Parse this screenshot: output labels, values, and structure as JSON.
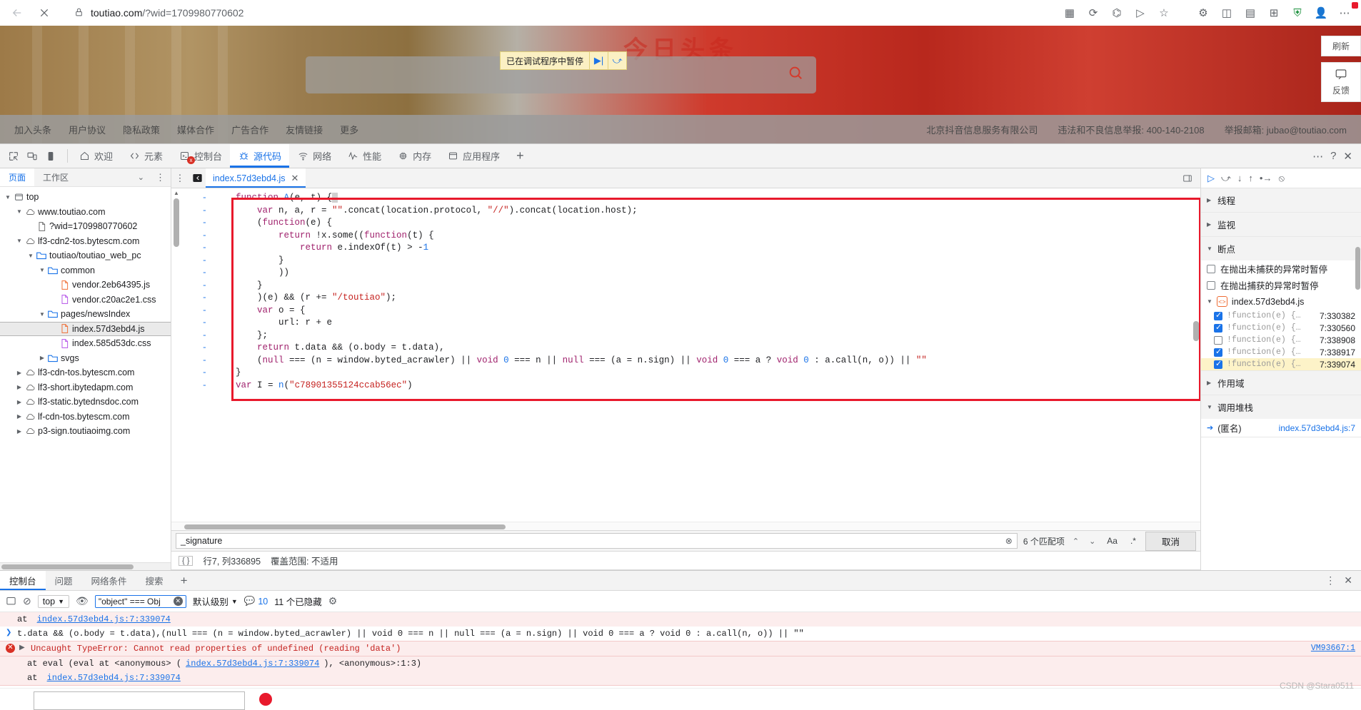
{
  "browser": {
    "url_main": "toutiao.com",
    "url_query": "/?wid=1709980770602",
    "lock_icon": "lock-icon",
    "back_icon": "←",
    "close_icon": "✕"
  },
  "page": {
    "watermark": "今日头条",
    "footer_links": [
      "加入头条",
      "用户协议",
      "隐私政策",
      "媒体合作",
      "广告合作",
      "友情链接",
      "更多"
    ],
    "footer_right": [
      "北京抖音信息服务有限公司",
      "违法和不良信息举报: 400-140-2108",
      "举报邮箱: jubao@toutiao.com"
    ],
    "pause_banner": "已在调试程序中暂停",
    "edge_buttons": [
      {
        "label": "刷新"
      },
      {
        "label": "反馈"
      }
    ]
  },
  "devtools": {
    "tabs": [
      {
        "label": "欢迎",
        "icon": "home-icon",
        "active": false
      },
      {
        "label": "元素",
        "icon": "code-icon",
        "active": false
      },
      {
        "label": "控制台",
        "icon": "console-icon",
        "active": false,
        "badge": "x"
      },
      {
        "label": "源代码",
        "icon": "bug-icon",
        "active": true
      },
      {
        "label": "网络",
        "icon": "wifi-icon",
        "active": false
      },
      {
        "label": "性能",
        "icon": "pulse-icon",
        "active": false
      },
      {
        "label": "内存",
        "icon": "chip-icon",
        "active": false
      },
      {
        "label": "应用程序",
        "icon": "app-icon",
        "active": false
      }
    ],
    "add_tab": "+",
    "navigator": {
      "tabs": [
        {
          "label": "页面",
          "active": true
        },
        {
          "label": "工作区",
          "active": false
        }
      ],
      "tree": [
        {
          "indent": 0,
          "twisty": "▼",
          "icon": "frame-icon",
          "label": "top"
        },
        {
          "indent": 1,
          "twisty": "▼",
          "icon": "cloud-icon",
          "label": "www.toutiao.com"
        },
        {
          "indent": 2,
          "twisty": "",
          "icon": "doc-icon",
          "label": "?wid=1709980770602"
        },
        {
          "indent": 1,
          "twisty": "▼",
          "icon": "cloud-icon",
          "label": "lf3-cdn2-tos.bytescm.com"
        },
        {
          "indent": 2,
          "twisty": "▼",
          "icon": "folder-icon",
          "label": "toutiao/toutiao_web_pc"
        },
        {
          "indent": 3,
          "twisty": "▼",
          "icon": "folder-icon",
          "label": "common"
        },
        {
          "indent": 4,
          "twisty": "",
          "icon": "js-icon",
          "label": "vendor.2eb64395.js"
        },
        {
          "indent": 4,
          "twisty": "",
          "icon": "css-icon",
          "label": "vendor.c20ac2e1.css"
        },
        {
          "indent": 3,
          "twisty": "▼",
          "icon": "folder-icon",
          "label": "pages/newsIndex"
        },
        {
          "indent": 4,
          "twisty": "",
          "icon": "js-icon",
          "label": "index.57d3ebd4.js",
          "selected": true
        },
        {
          "indent": 4,
          "twisty": "",
          "icon": "css-icon",
          "label": "index.585d53dc.css"
        },
        {
          "indent": 3,
          "twisty": "▶",
          "icon": "folder-icon",
          "label": "svgs"
        },
        {
          "indent": 1,
          "twisty": "▶",
          "icon": "cloud-icon",
          "label": "lf3-cdn-tos.bytescm.com"
        },
        {
          "indent": 1,
          "twisty": "▶",
          "icon": "cloud-icon",
          "label": "lf3-short.ibytedapm.com"
        },
        {
          "indent": 1,
          "twisty": "▶",
          "icon": "cloud-icon",
          "label": "lf3-static.bytednsdoc.com"
        },
        {
          "indent": 1,
          "twisty": "▶",
          "icon": "cloud-icon",
          "label": "lf-cdn-tos.bytescm.com"
        },
        {
          "indent": 1,
          "twisty": "▶",
          "icon": "cloud-icon",
          "label": "p3-sign.toutiaoimg.com"
        }
      ]
    },
    "editor": {
      "tab_label": "index.57d3ebd4.js",
      "line_marker": "-",
      "code_lines": [
        "    function A(e, t) {",
        "        var n, a, r = \"\".concat(location.protocol, \"//\").concat(location.host);",
        "        (function(e) {",
        "            return !x.some((function(t) {",
        "                return e.indexOf(t) > -1",
        "            }",
        "            ))",
        "        }",
        "        )(e) && (r += \"/toutiao\");",
        "        var o = {",
        "            url: r + e",
        "        };",
        "        return t.data && (o.body = t.data),",
        "        (null === (n = window.byted_acrawler) || void 0 === n || null === (a = n.sign) || void 0 === a ? void 0 : a.call(n, o)) || \"\"",
        "    }",
        "    var I = n(\"c78901355124ccab56ec\")"
      ],
      "find_value": "_signature",
      "find_matches": "6 个匹配项",
      "find_case": "Aa",
      "find_regex": ".*",
      "find_cancel": "取消",
      "status_position": "行7, 列336895",
      "status_coverage": "覆盖范围: 不适用"
    },
    "debug": {
      "sections": [
        {
          "label": "线程",
          "open": false
        },
        {
          "label": "监视",
          "open": false
        },
        {
          "label": "断点",
          "open": true
        },
        {
          "label": "作用域",
          "open": false
        },
        {
          "label": "调用堆栈",
          "open": true
        }
      ],
      "pause_options": [
        {
          "label": "在抛出未捕获的异常时暂停",
          "checked": false
        },
        {
          "label": "在抛出捕获的异常时暂停",
          "checked": false
        }
      ],
      "breakpoint_file": "index.57d3ebd4.js",
      "breakpoints": [
        {
          "code": "!function(e) {…",
          "loc": "7:330382",
          "checked": true,
          "highlighted": false
        },
        {
          "code": "!function(e) {…",
          "loc": "7:330560",
          "checked": true,
          "highlighted": false
        },
        {
          "code": "!function(e) {…",
          "loc": "7:338908",
          "checked": false,
          "highlighted": false
        },
        {
          "code": "!function(e) {…",
          "loc": "7:338917",
          "checked": true,
          "highlighted": false
        },
        {
          "code": "!function(e) {…",
          "loc": "7:339074",
          "checked": true,
          "highlighted": true
        }
      ],
      "call_stack": [
        {
          "name": "(匿名)",
          "loc": "index.57d3ebd4.js:7"
        }
      ]
    },
    "drawer": {
      "tabs": [
        {
          "label": "控制台",
          "active": true
        },
        {
          "label": "问题",
          "active": false
        },
        {
          "label": "网络条件",
          "active": false
        },
        {
          "label": "搜索",
          "active": false
        }
      ],
      "add_tab": "+",
      "console_context": "top",
      "filter_value": "\"object\" === Obj",
      "level": "默认级别",
      "message_count": "10",
      "hidden_count": "11 个已隐藏",
      "lines": [
        {
          "type": "trace",
          "text": "at index.57d3ebd4.js:7:339074",
          "link": "index.57d3ebd4.js:7:339074"
        },
        {
          "type": "input",
          "text": "t.data && (o.body = t.data),(null === (n = window.byted_acrawler) || void 0 === n || null === (a = n.sign) || void 0 === a ? void 0 : a.call(n, o)) || \"\""
        },
        {
          "type": "error",
          "text": "Uncaught TypeError: Cannot read properties of undefined (reading 'data')",
          "source": "VM93667:1"
        },
        {
          "type": "error-sub",
          "text": "at eval (eval at <anonymous> (index.57d3ebd4.js:7:339074), <anonymous>:1:3)",
          "link": "index.57d3ebd4.js:7:339074"
        },
        {
          "type": "error-sub",
          "text": "at index.57d3ebd4.js:7:339074",
          "link": "index.57d3ebd4.js:7:339074"
        }
      ],
      "prompt": ">"
    }
  },
  "watermark_credit": "CSDN @Stara0511"
}
